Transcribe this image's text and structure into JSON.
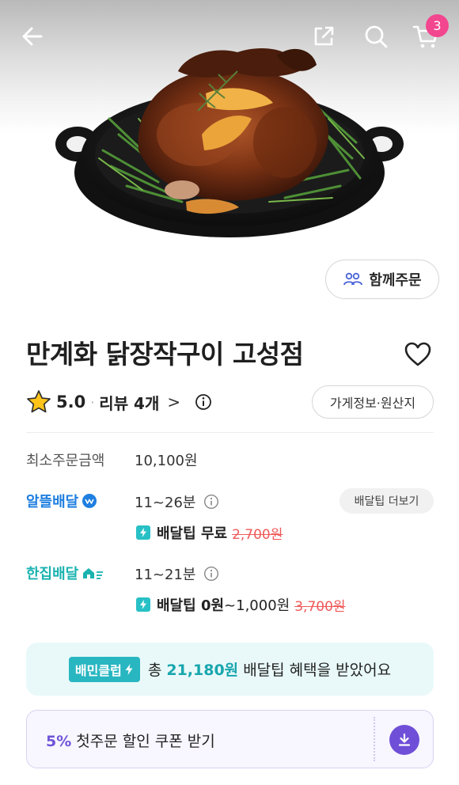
{
  "header": {
    "back_icon": "arrow-left-icon",
    "share_icon": "share-icon",
    "search_icon": "search-icon",
    "cart_icon": "cart-icon",
    "cart_count": "3"
  },
  "group_order": {
    "label": "함께주문",
    "icon": "people-icon"
  },
  "store": {
    "name": "만계화 닭장작구이 고성점",
    "rating": "5.0",
    "review_label": "리뷰 4개",
    "review_chevron": ">",
    "info_button": "가게정보·원산지"
  },
  "details": {
    "min_order_label": "최소주문금액",
    "min_order_value": "10,100원",
    "saver": {
      "label": "알뜰배달",
      "time": "11~26분",
      "tip_label": "배달팁 무료",
      "tip_original": "2,700원",
      "more_button": "배달팁 더보기"
    },
    "single": {
      "label": "한집배달",
      "time": "11~21분",
      "tip_label": "배달팁 0원",
      "tip_range": "~1,000원",
      "tip_original": "3,700원"
    }
  },
  "club_banner": {
    "badge": "배민클럽",
    "prefix": "총 ",
    "amount": "21,180원",
    "suffix": " 배달팁 혜택을 받았어요"
  },
  "coupon": {
    "percent": "5%",
    "text": " 첫주문 할인 쿠폰 받기",
    "icon": "download-icon"
  },
  "colors": {
    "cart_badge": "#f2468f",
    "saver_blue": "#1f7fe0",
    "single_teal": "#1ab3b0",
    "discount_red": "#f05a5a",
    "coupon_purple": "#6f4fd8"
  }
}
